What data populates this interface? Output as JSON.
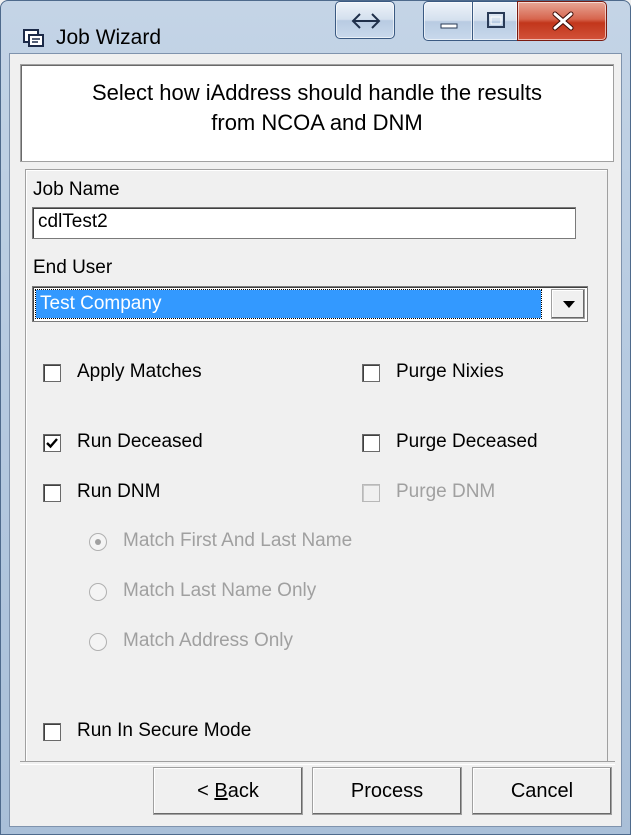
{
  "window": {
    "title": "Job Wizard",
    "accent_close": "#c2361b"
  },
  "header": {
    "line1": "Select how iAddress should handle the results",
    "line2": "from NCOA and DNM"
  },
  "form": {
    "job_name_label": "Job Name",
    "job_name_value": "cdlTest2",
    "end_user_label": "End User",
    "end_user_value": "Test Company"
  },
  "options": {
    "apply_matches": {
      "label": "Apply Matches",
      "checked": false,
      "enabled": true
    },
    "purge_nixies": {
      "label": "Purge Nixies",
      "checked": false,
      "enabled": true
    },
    "run_deceased": {
      "label": "Run Deceased",
      "checked": true,
      "enabled": true
    },
    "purge_deceased": {
      "label": "Purge Deceased",
      "checked": false,
      "enabled": true
    },
    "run_dnm": {
      "label": "Run DNM",
      "checked": false,
      "enabled": true
    },
    "purge_dnm": {
      "label": "Purge DNM",
      "checked": false,
      "enabled": false
    },
    "secure_mode": {
      "label": "Run In Secure Mode",
      "checked": false,
      "enabled": true
    }
  },
  "match_modes": [
    {
      "label": "Match First And Last Name",
      "selected": true,
      "enabled": false
    },
    {
      "label": "Match Last Name Only",
      "selected": false,
      "enabled": false
    },
    {
      "label": "Match Address Only",
      "selected": false,
      "enabled": false
    }
  ],
  "buttons": {
    "back_prefix": "< ",
    "back_mnemonic": "B",
    "back_rest": "ack",
    "process": "Process",
    "cancel": "Cancel"
  },
  "icons": {
    "app": "job-wizard-app-icon",
    "resize": "double-arrow-icon",
    "minimize": "minimize-icon",
    "maximize": "maximize-icon",
    "close": "close-x-icon",
    "dropdown": "chevron-down-icon",
    "check": "checkmark-icon"
  }
}
